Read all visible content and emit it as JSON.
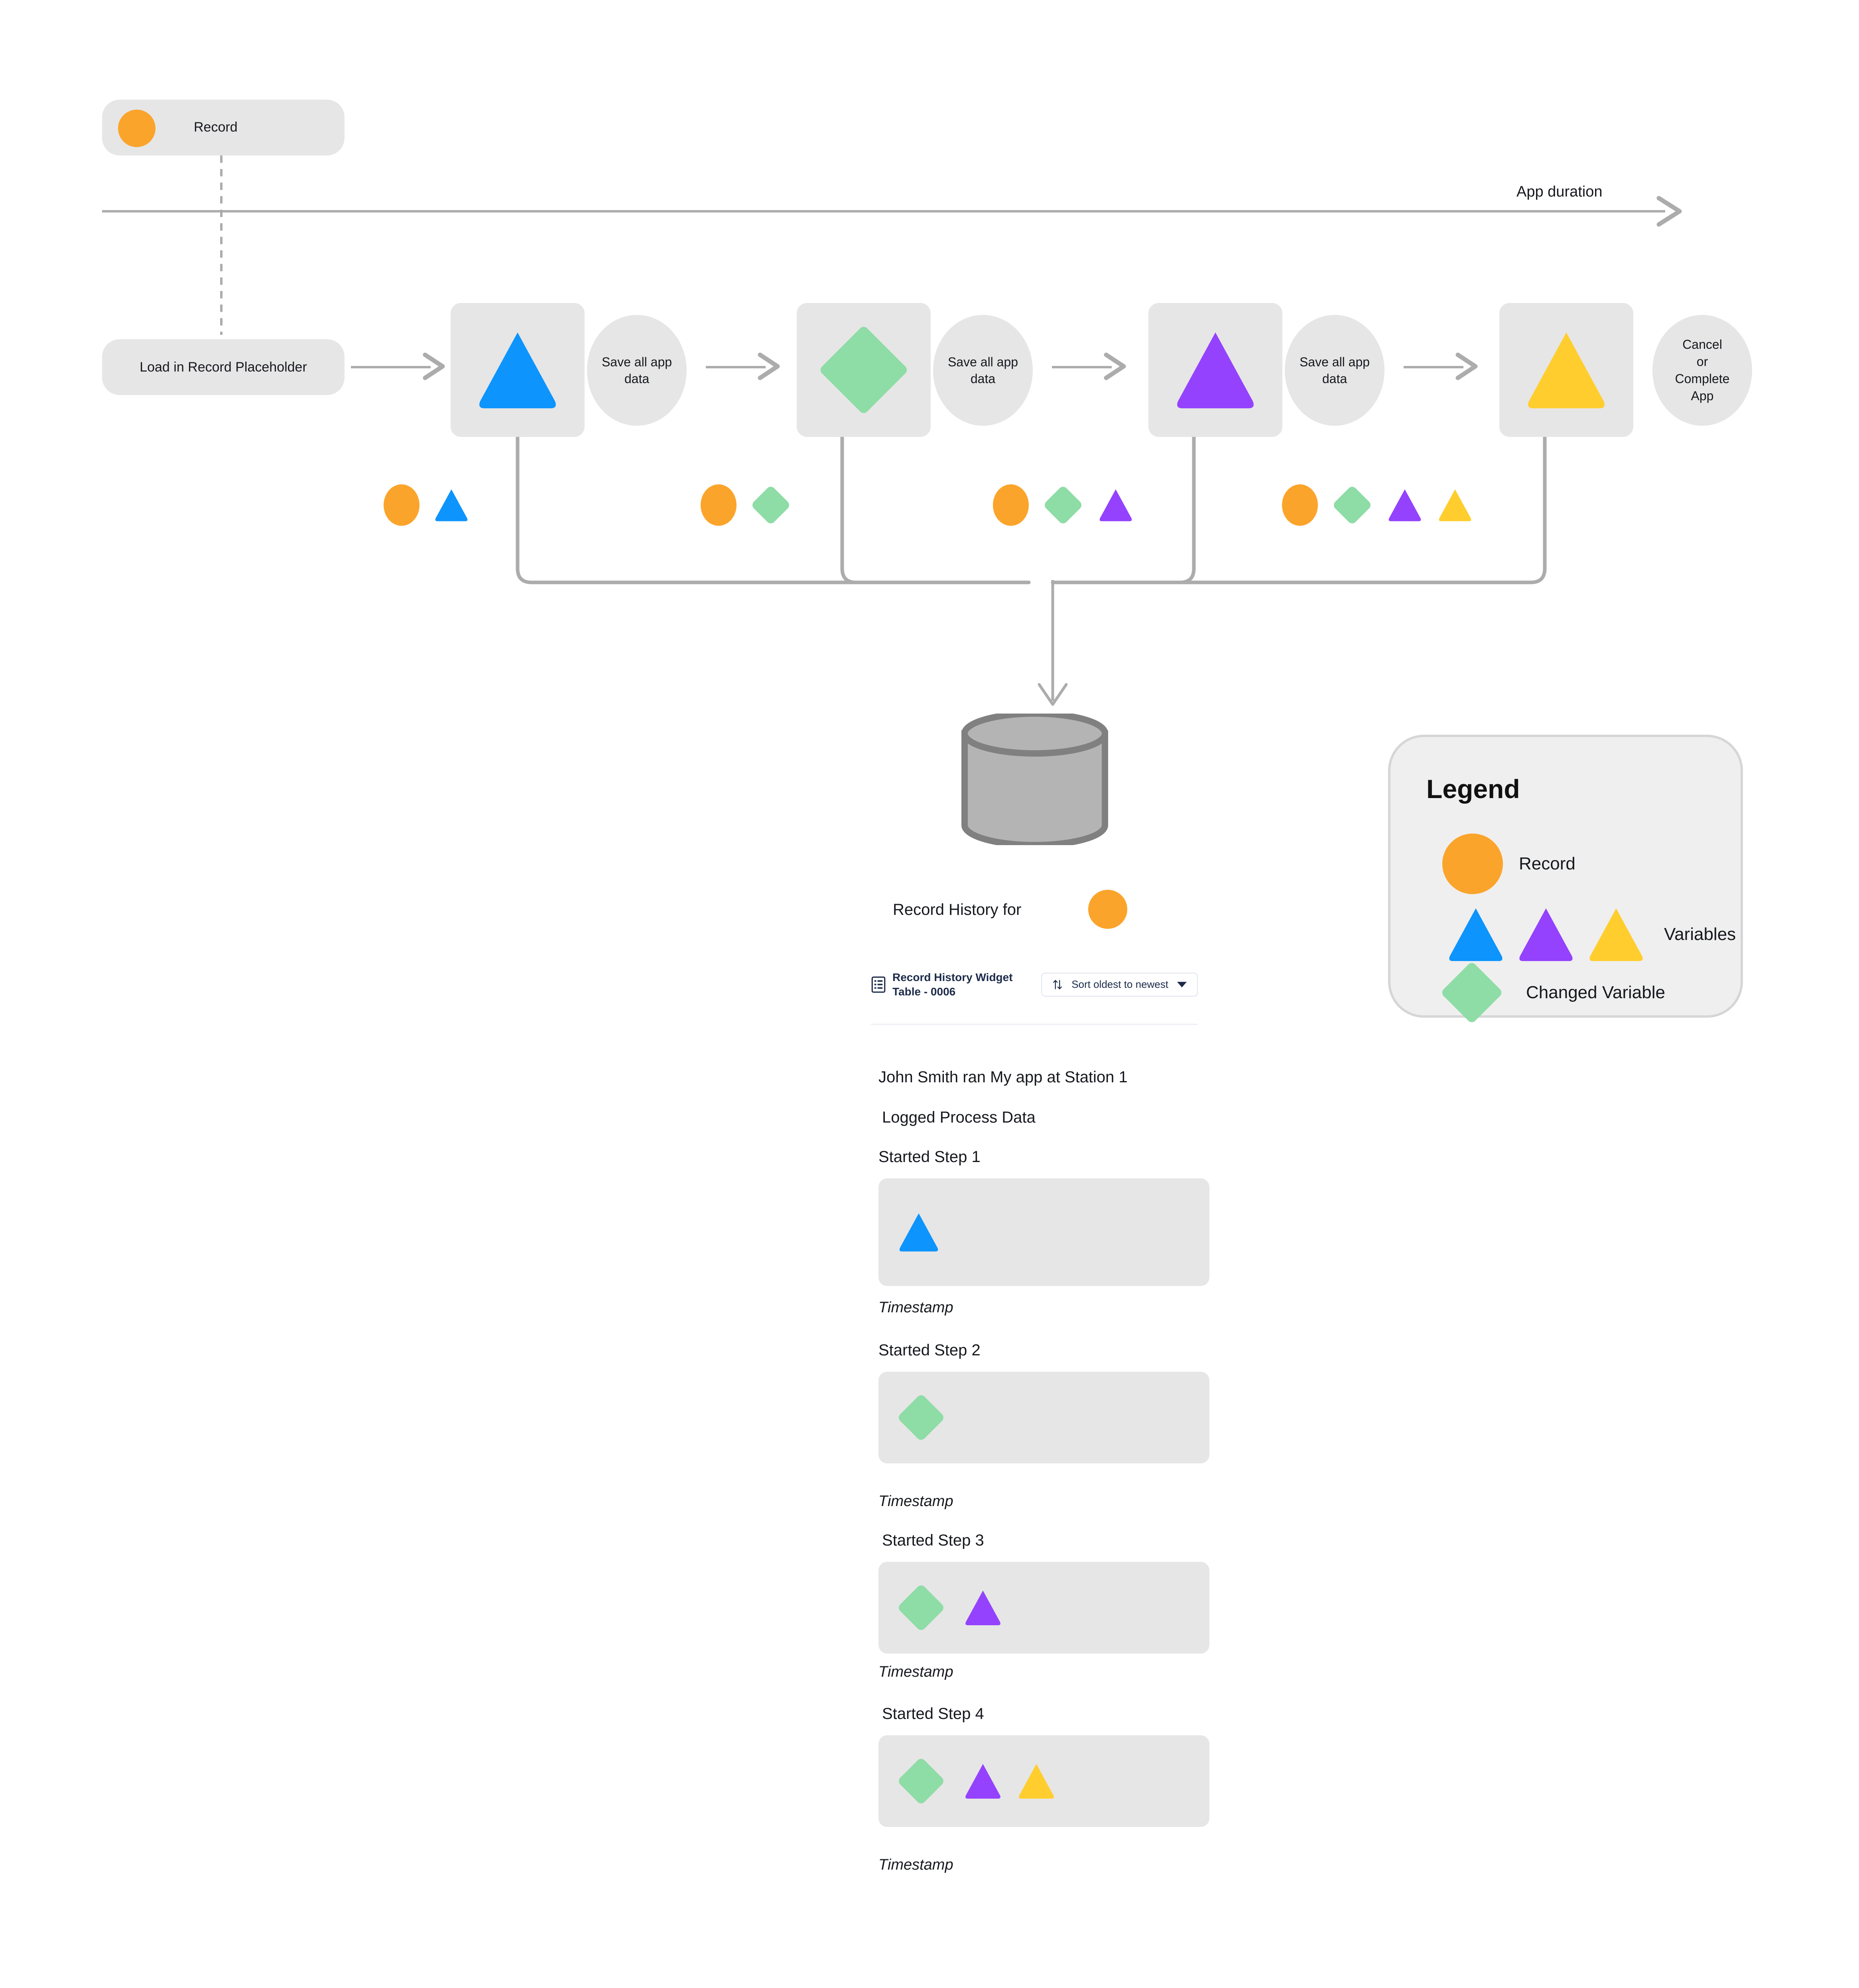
{
  "palette": {
    "record_orange": "#FBA42B",
    "variable_blue": "#0D94FD",
    "variable_purple": "#9442FD",
    "variable_yellow": "#FFCE2E",
    "changed_green": "#8EDCA6",
    "box_grey": "#E6E6E6",
    "line_grey": "#ACACAC",
    "cylinder_fill": "#B4B4B4",
    "cylinder_stroke": "#808080"
  },
  "record_badge": {
    "label": "Record",
    "icon": "record-circle-icon"
  },
  "timeline": {
    "label": "App duration"
  },
  "flow": {
    "start_node": {
      "label": "Load in Record Placeholder"
    },
    "save_label": "Save all app data",
    "end_node": {
      "lines": [
        "Cancel",
        "or",
        "Complete",
        "App"
      ]
    },
    "steps": [
      {
        "name": "step-1",
        "shape": "triangle",
        "color": "#0D94FD"
      },
      {
        "name": "step-2",
        "shape": "diamond",
        "color": "#8EDCA6"
      },
      {
        "name": "step-3",
        "shape": "triangle",
        "color": "#9442FD"
      },
      {
        "name": "step-4",
        "shape": "triangle",
        "color": "#FFCE2E"
      }
    ],
    "accumulation_rows": [
      {
        "for_step": "step-1",
        "shapes": [
          {
            "shape": "ellipse",
            "color": "#FBA42B",
            "name": "record-shape"
          },
          {
            "shape": "triangle",
            "color": "#0D94FD",
            "name": "variable-blue-shape"
          }
        ]
      },
      {
        "for_step": "step-2",
        "shapes": [
          {
            "shape": "ellipse",
            "color": "#FBA42B",
            "name": "record-shape"
          },
          {
            "shape": "diamond",
            "color": "#8EDCA6",
            "name": "changed-variable-shape"
          }
        ]
      },
      {
        "for_step": "step-3",
        "shapes": [
          {
            "shape": "ellipse",
            "color": "#FBA42B",
            "name": "record-shape"
          },
          {
            "shape": "diamond",
            "color": "#8EDCA6",
            "name": "changed-variable-shape"
          },
          {
            "shape": "triangle",
            "color": "#9442FD",
            "name": "variable-purple-shape"
          }
        ]
      },
      {
        "for_step": "step-4",
        "shapes": [
          {
            "shape": "ellipse",
            "color": "#FBA42B",
            "name": "record-shape"
          },
          {
            "shape": "diamond",
            "color": "#8EDCA6",
            "name": "changed-variable-shape"
          },
          {
            "shape": "triangle",
            "color": "#9442FD",
            "name": "variable-purple-shape"
          },
          {
            "shape": "triangle",
            "color": "#FFCE2E",
            "name": "variable-yellow-shape"
          }
        ]
      }
    ]
  },
  "database": {
    "caption": "Record History for",
    "icon": "database-cylinder-icon"
  },
  "record_history_widget": {
    "title": "Record History Widget Table - 0006",
    "icon": "table-list-icon",
    "sort": {
      "label": "Sort oldest to newest",
      "icon": "sort-arrows-icon",
      "caret": "chevron-down-icon"
    },
    "entries": [
      {
        "text": "John Smith ran My app at Station 1",
        "box": null,
        "timestamp": null
      },
      {
        "text": "Logged Process Data",
        "box": null,
        "timestamp": null
      },
      {
        "text": "Started Step 1",
        "timestamp": "Timestamp",
        "box": [
          {
            "shape": "triangle",
            "color": "#0D94FD",
            "name": "variable-blue-shape"
          }
        ]
      },
      {
        "text": "Started Step 2",
        "timestamp": "Timestamp",
        "box": [
          {
            "shape": "diamond",
            "color": "#8EDCA6",
            "name": "changed-variable-shape"
          }
        ]
      },
      {
        "text": "Started Step 3",
        "timestamp": "Timestamp",
        "box": [
          {
            "shape": "diamond",
            "color": "#8EDCA6",
            "name": "changed-variable-shape"
          },
          {
            "shape": "triangle",
            "color": "#9442FD",
            "name": "variable-purple-shape"
          }
        ]
      },
      {
        "text": "Started Step 4",
        "timestamp": "Timestamp",
        "box": [
          {
            "shape": "diamond",
            "color": "#8EDCA6",
            "name": "changed-variable-shape"
          },
          {
            "shape": "triangle",
            "color": "#9442FD",
            "name": "variable-purple-shape"
          },
          {
            "shape": "triangle",
            "color": "#FFCE2E",
            "name": "variable-yellow-shape"
          }
        ]
      }
    ]
  },
  "legend": {
    "title": "Legend",
    "rows": [
      {
        "label": "Record",
        "shapes": [
          {
            "shape": "circle",
            "color": "#FBA42B",
            "name": "record-shape"
          }
        ]
      },
      {
        "label": "Variables",
        "shapes": [
          {
            "shape": "triangle",
            "color": "#0D94FD",
            "name": "variable-blue-shape"
          },
          {
            "shape": "triangle",
            "color": "#9442FD",
            "name": "variable-purple-shape"
          },
          {
            "shape": "triangle",
            "color": "#FFCE2E",
            "name": "variable-yellow-shape"
          }
        ]
      },
      {
        "label": "Changed Variable",
        "shapes": [
          {
            "shape": "diamond",
            "color": "#8EDCA6",
            "name": "changed-variable-shape"
          }
        ]
      }
    ]
  }
}
